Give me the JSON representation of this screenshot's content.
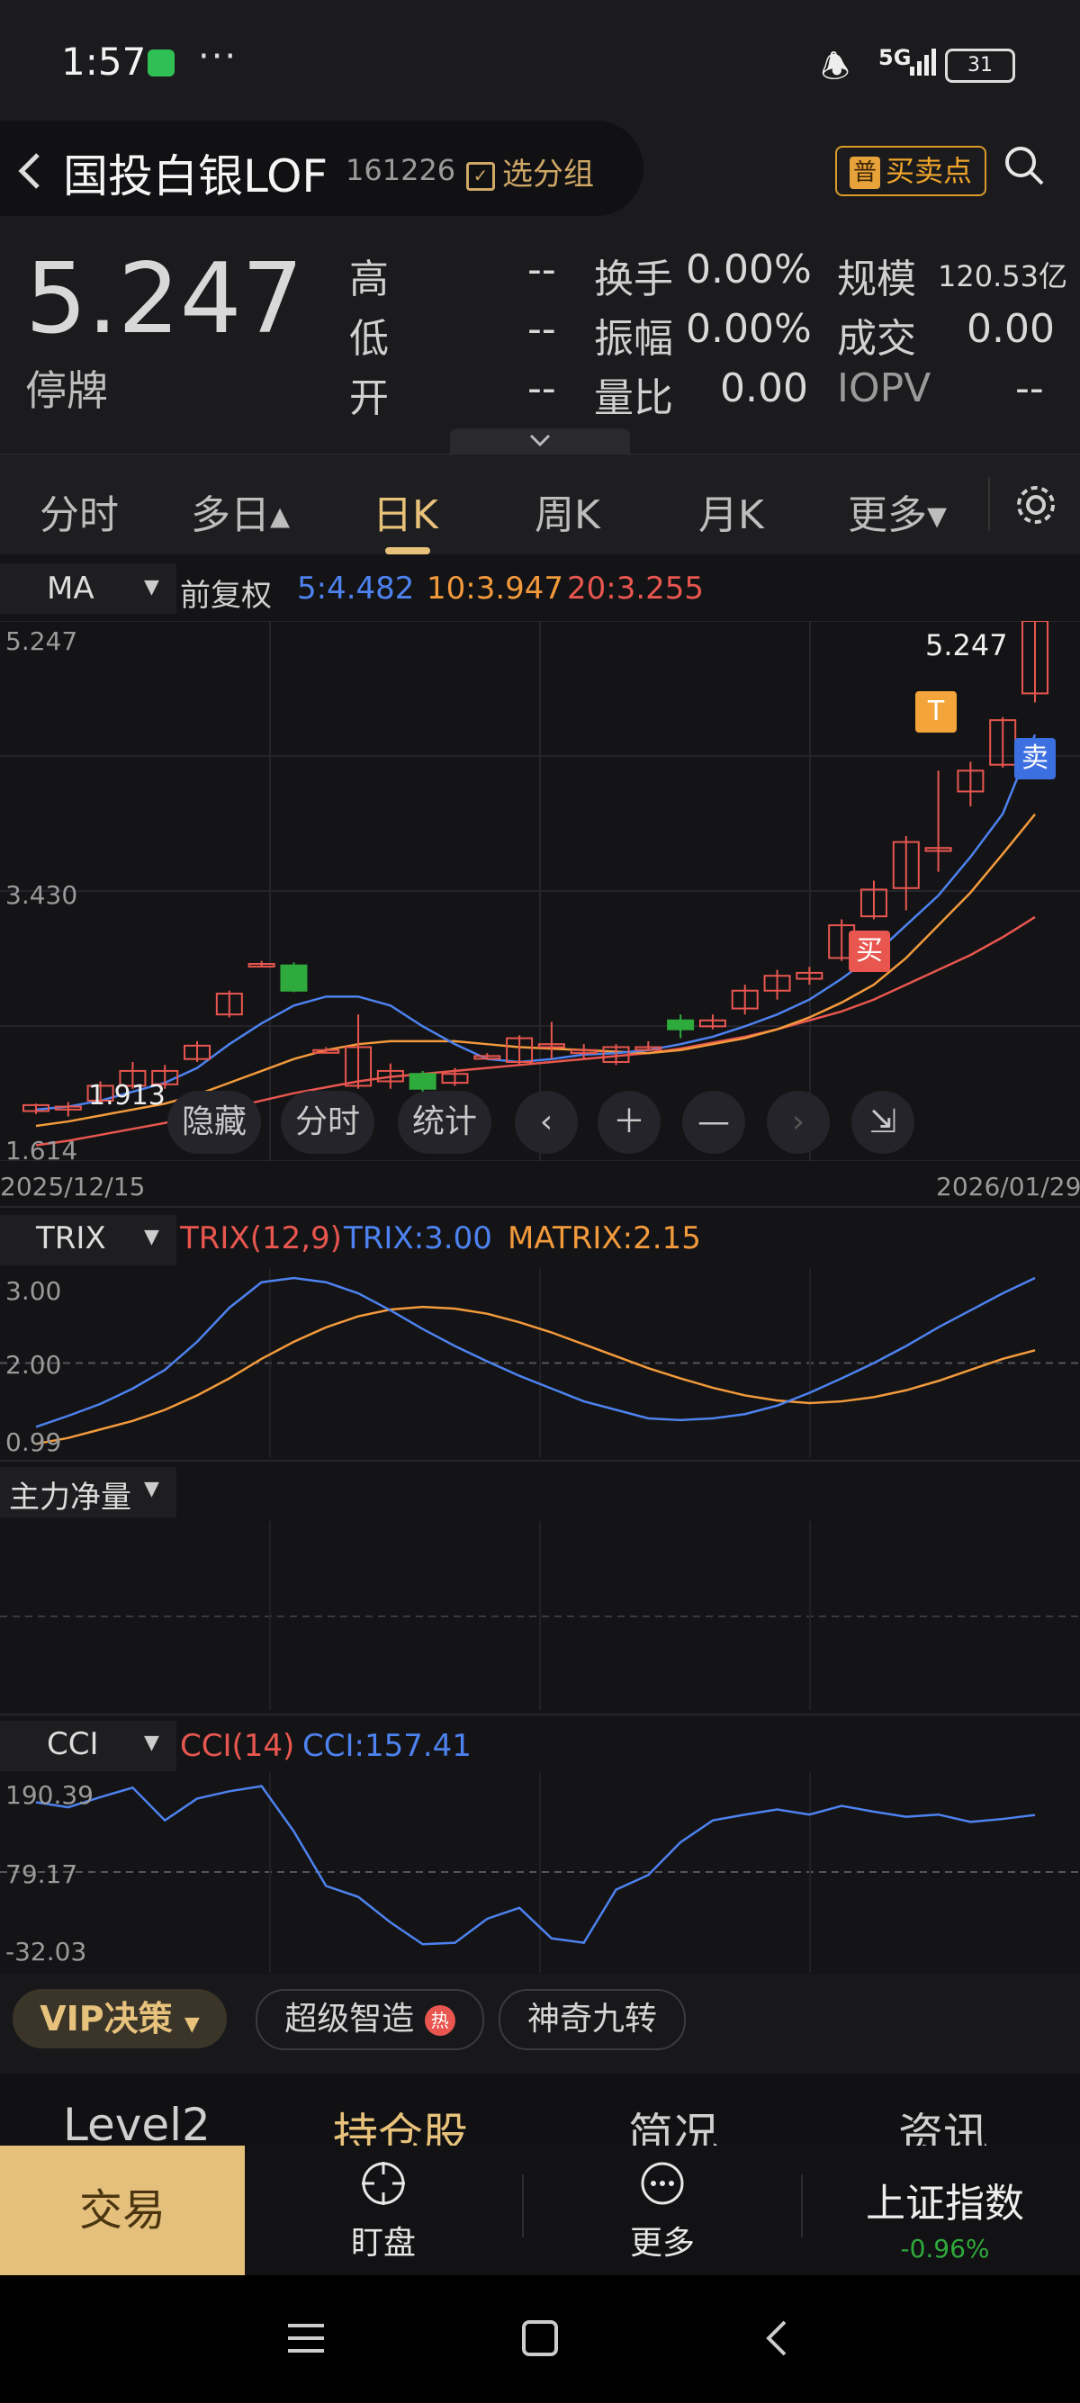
{
  "status_bar": {
    "time": "1:57",
    "dots": "···",
    "network": "5G",
    "battery": "31"
  },
  "header": {
    "back_icon": "chevron-left-icon",
    "title": "国投白银LOF",
    "code": "161226",
    "group_label": "选分组",
    "buy_sell_label": "买卖点",
    "buy_sell_badge": "普"
  },
  "quote": {
    "price": "5.247",
    "status": "停牌",
    "rows": [
      {
        "l1": "高",
        "v1": "--",
        "l2": "换手",
        "v2": "0.00%",
        "l3": "规模",
        "v3": "120.53亿"
      },
      {
        "l1": "低",
        "v1": "--",
        "l2": "振幅",
        "v2": "0.00%",
        "l3": "成交",
        "v3": "0.00"
      },
      {
        "l1": "开",
        "v1": "--",
        "l2": "量比",
        "v2": "0.00",
        "l3": "IOPV",
        "v3": "--"
      }
    ]
  },
  "tabs": [
    {
      "label": "分时"
    },
    {
      "label": "多日▴"
    },
    {
      "label": "日K"
    },
    {
      "label": "周K"
    },
    {
      "label": "月K"
    },
    {
      "label": "更多▾"
    }
  ],
  "colors": {
    "up": "#e8564f",
    "down": "#2faa3c",
    "ma5": "#4d82f0",
    "ma10": "#f39a3c",
    "ma20": "#e8564f",
    "accent": "#e8c27a"
  },
  "kline": {
    "indicator": "MA",
    "adjust": "前复权",
    "ma5": "5:4.482",
    "ma10": "10:3.947",
    "ma20": "20:3.255",
    "y_top": "5.247",
    "y_mid": "3.430",
    "y_bottom": "1.614",
    "min_label": "1.913",
    "max_label": "5.247",
    "date_start": "2025/12/15",
    "date_end": "2026/01/29",
    "t_marker": "T",
    "buy_marker": "买",
    "sell_marker": "卖",
    "tool_hide": "隐藏",
    "tool_time": "分时",
    "tool_stats": "统计"
  },
  "trix": {
    "indicator": "TRIX",
    "title": "TRIX(12,9)",
    "trix": "TRIX:3.00",
    "matrix": "MATRIX:2.15",
    "y_top": "3.00",
    "y_mid": "2.00",
    "y_bottom": "0.99"
  },
  "mainforce": {
    "indicator": "主力净量"
  },
  "cci": {
    "indicator": "CCI",
    "title": "CCI(14)",
    "value": "CCI:157.41",
    "y_top": "190.39",
    "y_mid": "79.17",
    "y_bottom": "-32.03"
  },
  "toolbar": {
    "vip": "VIP决策",
    "smart": "超级智造",
    "hot": "热",
    "nine": "神奇九转"
  },
  "info_tabs": [
    "Level2",
    "持仓股",
    "简况",
    "资讯"
  ],
  "bottom_nav": {
    "trade": "交易",
    "watch": "盯盘",
    "more": "更多",
    "index_name": "上证指数",
    "index_change": "-0.96%"
  },
  "chart_data": {
    "type": "candlestick",
    "dates": [
      "2025/12/15",
      "2026/01/29"
    ],
    "ylim": [
      1.614,
      5.247
    ],
    "candles": [
      {
        "o": 1.95,
        "c": 1.99,
        "h": 2.0,
        "l": 1.93
      },
      {
        "o": 1.96,
        "c": 1.98,
        "h": 2.01,
        "l": 1.913
      },
      {
        "o": 2.02,
        "c": 2.12,
        "h": 2.15,
        "l": 2.0
      },
      {
        "o": 2.12,
        "c": 2.22,
        "h": 2.28,
        "l": 2.1
      },
      {
        "o": 2.13,
        "c": 2.22,
        "h": 2.26,
        "l": 2.1
      },
      {
        "o": 2.3,
        "c": 2.39,
        "h": 2.42,
        "l": 2.28
      },
      {
        "o": 2.6,
        "c": 2.74,
        "h": 2.76,
        "l": 2.58
      },
      {
        "o": 2.94,
        "c": 2.94,
        "h": 2.96,
        "l": 2.92
      },
      {
        "o": 2.93,
        "c": 2.76,
        "h": 2.95,
        "l": 2.75
      },
      {
        "o": 2.36,
        "c": 2.36,
        "h": 2.38,
        "l": 2.34
      },
      {
        "o": 2.12,
        "c": 2.38,
        "h": 2.6,
        "l": 2.1
      },
      {
        "o": 2.15,
        "c": 2.22,
        "h": 2.27,
        "l": 2.1
      },
      {
        "o": 2.2,
        "c": 2.1,
        "h": 2.22,
        "l": 2.05
      },
      {
        "o": 2.14,
        "c": 2.2,
        "h": 2.24,
        "l": 2.12
      },
      {
        "o": 2.32,
        "c": 2.32,
        "h": 2.34,
        "l": 2.3
      },
      {
        "o": 2.28,
        "c": 2.44,
        "h": 2.46,
        "l": 2.26
      },
      {
        "o": 2.38,
        "c": 2.4,
        "h": 2.55,
        "l": 2.3
      },
      {
        "o": 2.34,
        "c": 2.36,
        "h": 2.4,
        "l": 2.3
      },
      {
        "o": 2.28,
        "c": 2.38,
        "h": 2.4,
        "l": 2.26
      },
      {
        "o": 2.38,
        "c": 2.38,
        "h": 2.42,
        "l": 2.36
      },
      {
        "o": 2.56,
        "c": 2.5,
        "h": 2.6,
        "l": 2.44
      },
      {
        "o": 2.52,
        "c": 2.56,
        "h": 2.6,
        "l": 2.5
      },
      {
        "o": 2.64,
        "c": 2.76,
        "h": 2.8,
        "l": 2.6
      },
      {
        "o": 2.76,
        "c": 2.86,
        "h": 2.9,
        "l": 2.7
      },
      {
        "o": 2.84,
        "c": 2.88,
        "h": 2.92,
        "l": 2.8
      },
      {
        "o": 2.98,
        "c": 3.2,
        "h": 3.24,
        "l": 2.96
      },
      {
        "o": 3.26,
        "c": 3.44,
        "h": 3.5,
        "l": 3.24
      },
      {
        "o": 3.45,
        "c": 3.76,
        "h": 3.8,
        "l": 3.3
      },
      {
        "o": 3.7,
        "c": 3.72,
        "h": 4.24,
        "l": 3.56
      },
      {
        "o": 4.1,
        "c": 4.24,
        "h": 4.3,
        "l": 4.0
      },
      {
        "o": 4.28,
        "c": 4.58,
        "h": 4.6,
        "l": 4.26
      },
      {
        "o": 4.76,
        "c": 5.247,
        "h": 5.247,
        "l": 4.7
      }
    ],
    "ma5": [
      1.96,
      1.98,
      2.02,
      2.08,
      2.14,
      2.24,
      2.4,
      2.54,
      2.66,
      2.72,
      2.72,
      2.66,
      2.52,
      2.4,
      2.3,
      2.28,
      2.3,
      2.33,
      2.34,
      2.36,
      2.4,
      2.45,
      2.52,
      2.6,
      2.7,
      2.84,
      3.0,
      3.2,
      3.4,
      3.66,
      3.95,
      4.482
    ],
    "ma10": [
      1.85,
      1.88,
      1.92,
      1.96,
      2.0,
      2.06,
      2.14,
      2.22,
      2.3,
      2.36,
      2.4,
      2.42,
      2.42,
      2.42,
      2.4,
      2.38,
      2.37,
      2.36,
      2.35,
      2.34,
      2.36,
      2.4,
      2.44,
      2.5,
      2.58,
      2.68,
      2.8,
      2.98,
      3.2,
      3.42,
      3.68,
      3.947
    ],
    "ma20": [
      1.72,
      1.75,
      1.79,
      1.83,
      1.87,
      1.92,
      1.97,
      2.02,
      2.07,
      2.11,
      2.15,
      2.18,
      2.2,
      2.22,
      2.24,
      2.26,
      2.28,
      2.3,
      2.32,
      2.34,
      2.37,
      2.41,
      2.45,
      2.5,
      2.56,
      2.62,
      2.7,
      2.8,
      2.9,
      3.0,
      3.12,
      3.255
    ],
    "trix": {
      "ylim": [
        0.99,
        3.0
      ],
      "trix": [
        1.25,
        1.38,
        1.52,
        1.7,
        1.92,
        2.25,
        2.65,
        2.95,
        3.0,
        2.95,
        2.82,
        2.62,
        2.4,
        2.2,
        2.02,
        1.85,
        1.7,
        1.55,
        1.45,
        1.35,
        1.33,
        1.35,
        1.4,
        1.5,
        1.65,
        1.82,
        2.0,
        2.2,
        2.42,
        2.62,
        2.82,
        3.0
      ],
      "matrix": [
        1.05,
        1.12,
        1.22,
        1.32,
        1.45,
        1.62,
        1.82,
        2.05,
        2.25,
        2.42,
        2.55,
        2.63,
        2.66,
        2.64,
        2.58,
        2.48,
        2.36,
        2.22,
        2.08,
        1.94,
        1.82,
        1.71,
        1.62,
        1.56,
        1.53,
        1.55,
        1.6,
        1.68,
        1.79,
        1.92,
        2.05,
        2.15
      ]
    },
    "cci": {
      "ylim": [
        -32.03,
        190.39
      ],
      "values": [
        175,
        168,
        182,
        195,
        150,
        180,
        190,
        197,
        135,
        60,
        45,
        10,
        -20,
        -18,
        15,
        30,
        -12,
        -18,
        55,
        75,
        120,
        150,
        158,
        165,
        158,
        170,
        162,
        155,
        158,
        148,
        152,
        157.41
      ]
    }
  }
}
